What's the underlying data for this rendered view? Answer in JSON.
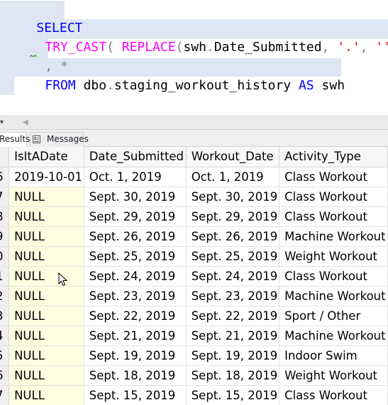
{
  "editor": {
    "line1": {
      "select": "SELECT"
    },
    "line2": {
      "try_cast": "TRY_CAST",
      "paren_open": "(",
      "replace": "REPLACE",
      "paren2": "(",
      "alias": "swh",
      "dot": ".",
      "column": "Date_Submitted",
      "comma1": ",",
      "str_dot": "'.'",
      "comma2": ",",
      "str_empty": "''",
      "paren_close": ")"
    },
    "line3": {
      "comma": ",",
      "star": "*"
    },
    "line4": {
      "from": "FROM",
      "schema": "dbo",
      "dot": ".",
      "table": "staging_workout_history",
      "as": "AS",
      "alias": "swh"
    }
  },
  "tabs": {
    "results": "Results",
    "messages": "Messages"
  },
  "grid": {
    "columns": [
      "IsItADate",
      "Date_Submitted",
      "Workout_Date",
      "Activity_Type"
    ],
    "rows": [
      {
        "n": "6",
        "c": [
          "2019-10-01",
          "Oct. 1, 2019",
          "Oct. 1, 2019",
          "Class Workout"
        ]
      },
      {
        "n": "7",
        "c": [
          "NULL",
          "Sept. 30, 2019",
          "Sept. 30, 2019",
          "Class Workout"
        ]
      },
      {
        "n": "8",
        "c": [
          "NULL",
          "Sept. 29, 2019",
          "Sept. 29, 2019",
          "Class Workout"
        ]
      },
      {
        "n": "9",
        "c": [
          "NULL",
          "Sept. 26, 2019",
          "Sept. 26, 2019",
          "Machine Workout"
        ]
      },
      {
        "n": "0",
        "c": [
          "NULL",
          "Sept. 25, 2019",
          "Sept. 25, 2019",
          "Weight Workout"
        ]
      },
      {
        "n": "1",
        "c": [
          "NULL",
          "Sept. 24, 2019",
          "Sept. 24, 2019",
          "Class Workout"
        ]
      },
      {
        "n": "2",
        "c": [
          "NULL",
          "Sept. 23, 2019",
          "Sept. 23, 2019",
          "Machine Workout"
        ]
      },
      {
        "n": "3",
        "c": [
          "NULL",
          "Sept. 22, 2019",
          "Sept. 22, 2019",
          "Sport / Other"
        ]
      },
      {
        "n": "4",
        "c": [
          "NULL",
          "Sept. 21, 2019",
          "Sept. 21, 2019",
          "Machine Workout"
        ]
      },
      {
        "n": "5",
        "c": [
          "NULL",
          "Sept. 19, 2019",
          "Sept. 19, 2019",
          "Indoor Swim"
        ]
      },
      {
        "n": "6",
        "c": [
          "NULL",
          "Sept. 18, 2019",
          "Sept. 18, 2019",
          "Weight Workout"
        ]
      },
      {
        "n": "7",
        "c": [
          "NULL",
          "Sept. 15, 2019",
          "Sept. 15, 2019",
          "Class Workout"
        ]
      }
    ]
  }
}
